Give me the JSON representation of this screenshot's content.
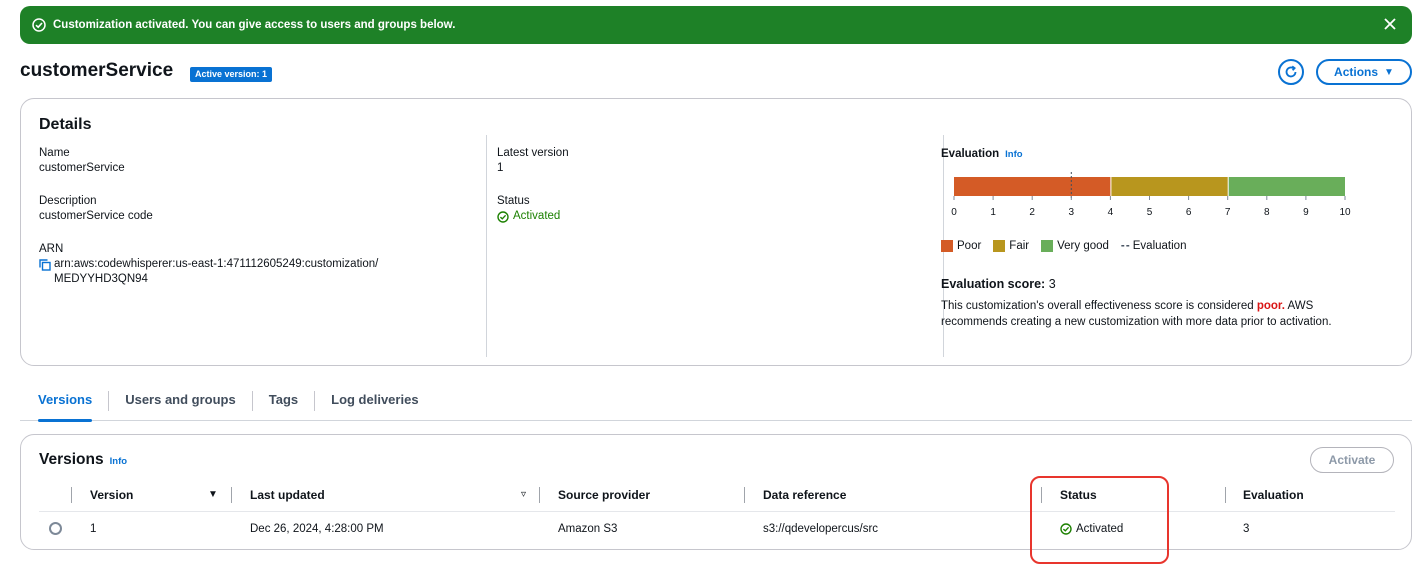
{
  "flash": {
    "message": "Customization activated. You can give access to users and groups below.",
    "icons": {
      "status": "check-circle-icon",
      "dismiss": "close-icon"
    }
  },
  "header": {
    "title": "customerService",
    "badge": "Active version: 1",
    "actions_label": "Actions"
  },
  "details": {
    "title": "Details",
    "name_label": "Name",
    "name_value": "customerService",
    "description_label": "Description",
    "description_value": "customerService code",
    "arn_label": "ARN",
    "arn_value": "arn:aws:codewhisperer:us-east-1:471112605249:customization/ MEDYYHD3QN94",
    "latest_version_label": "Latest version",
    "latest_version_value": "1",
    "status_label": "Status",
    "status_value": "Activated"
  },
  "evaluation": {
    "title": "Evaluation",
    "info": "Info",
    "score_label": "Evaluation score:",
    "score_value": "3",
    "desc_before": "This customization's overall effectiveness score is considered ",
    "desc_rating": "poor.",
    "desc_after": " AWS recommends creating a new customization with more data prior to activation.",
    "legend": [
      {
        "label": "Poor",
        "color": "#d45b26"
      },
      {
        "label": "Fair",
        "color": "#b8961e"
      },
      {
        "label": "Very good",
        "color": "#69ae5a"
      }
    ],
    "legend_marker_label": "Evaluation"
  },
  "chart_data": {
    "type": "bar",
    "orientation": "horizontal-stacked",
    "xlim": [
      0,
      10
    ],
    "ticks": [
      "0",
      "1",
      "2",
      "3",
      "4",
      "5",
      "6",
      "7",
      "8",
      "9",
      "10"
    ],
    "segments": [
      {
        "name": "Poor",
        "from": 0,
        "to": 4,
        "color": "#d45b26"
      },
      {
        "name": "Fair",
        "from": 4,
        "to": 7,
        "color": "#b8961e"
      },
      {
        "name": "Very good",
        "from": 7,
        "to": 10,
        "color": "#69ae5a"
      }
    ],
    "evaluation_marker": 3
  },
  "tabs": [
    {
      "label": "Versions",
      "active": true
    },
    {
      "label": "Users and groups",
      "active": false
    },
    {
      "label": "Tags",
      "active": false
    },
    {
      "label": "Log deliveries",
      "active": false
    }
  ],
  "versions_table": {
    "title": "Versions",
    "info": "Info",
    "activate_label": "Activate",
    "columns": [
      "Version",
      "Last updated",
      "Source provider",
      "Data reference",
      "Status",
      "Evaluation"
    ],
    "rows": [
      {
        "version": "1",
        "last_updated": "Dec 26, 2024, 4:28:00 PM",
        "source_provider": "Amazon S3",
        "data_reference": "s3://qdevelopercus/src",
        "status": "Activated",
        "evaluation": "3"
      }
    ]
  },
  "colors": {
    "success_banner": "#1e8127",
    "accent": "#0972d3",
    "status_ok": "#1d8102",
    "highlight": "#e8352d"
  }
}
